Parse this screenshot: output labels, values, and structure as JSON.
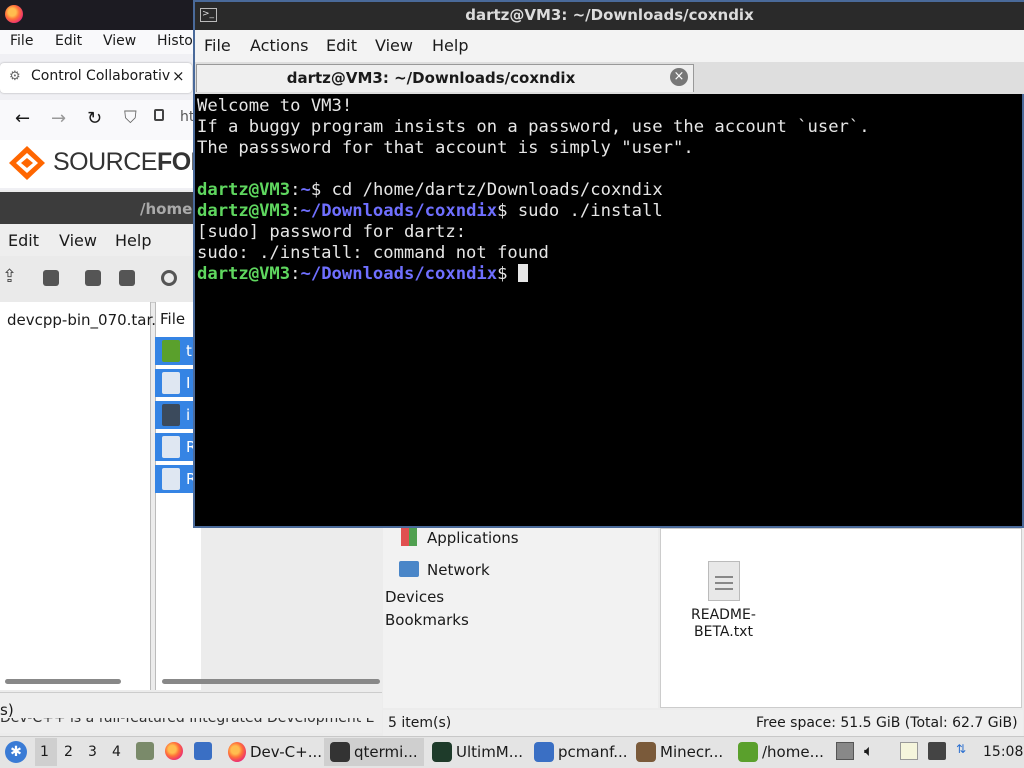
{
  "firefox": {
    "menu": [
      "File",
      "Edit",
      "View",
      "Histo"
    ],
    "tab_title": "Control Collaborative",
    "url_fragment": "ht",
    "sourceforge_text_a": "SOURCE",
    "sourceforge_text_b": "FOR",
    "behind_text": "Dev-C++ is a full-featured Integrated Development E"
  },
  "file_roller": {
    "title_fragment": "/home",
    "menu": [
      "Edit",
      "View",
      "Help"
    ],
    "left_item": "devcpp-bin_070.tar.",
    "column_header": "File",
    "row_letters": [
      "t",
      "I",
      "i",
      "R",
      "R"
    ],
    "status": "s)"
  },
  "pcmanfm": {
    "side_items": [
      "Applications",
      "Network"
    ],
    "side_sections": [
      "Devices",
      "Bookmarks"
    ],
    "file_name_1": "README-",
    "file_name_2": "BETA.txt",
    "status_items": "5 item(s)",
    "status_space": "Free space: 51.5 GiB (Total: 62.7 GiB)"
  },
  "terminal": {
    "window_title": "dartz@VM3: ~/Downloads/coxndix",
    "menu": [
      "File",
      "Actions",
      "Edit",
      "View",
      "Help"
    ],
    "tab_title": "dartz@VM3: ~/Downloads/coxndix",
    "lines": {
      "l1": "Welcome to VM3!",
      "l2": "If a buggy program insists on a password, use the account `user`.",
      "l3": "The passsword for that account is simply \"user\".",
      "p_user": "dartz@VM3",
      "p_colon": ":",
      "p_home": "~",
      "p_dir": "~/Downloads/coxndix",
      "p_dollar": "$",
      "cmd1": " cd /home/dartz/Downloads/coxndix",
      "cmd2": " sudo ./install",
      "l6": "[sudo] password for dartz:",
      "l7": "sudo: ./install: command not found",
      "cmd3": " "
    }
  },
  "taskbar": {
    "workspaces": [
      "1",
      "2",
      "3",
      "4"
    ],
    "tasks": [
      "Dev-C+...",
      "qtermi...",
      "UltimM...",
      "pcmanf...",
      "Minecr...",
      "/home..."
    ],
    "clock": "15:08",
    "accent": "#3a7bd5"
  }
}
